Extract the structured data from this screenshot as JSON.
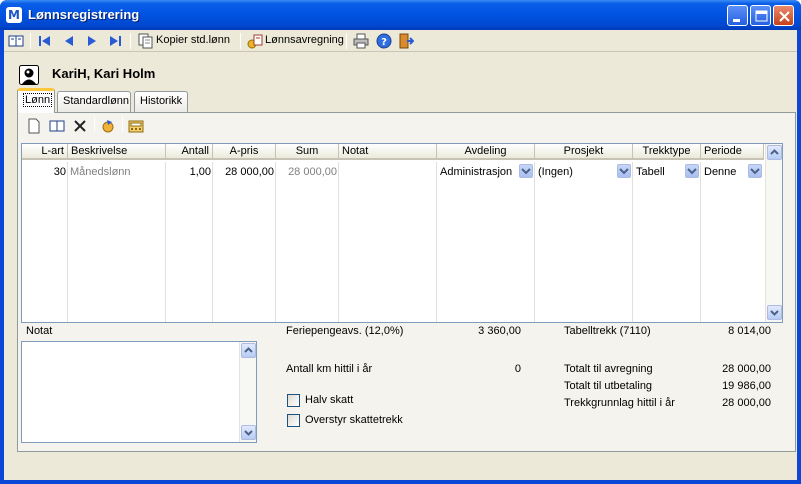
{
  "window": {
    "title": "Lønnsregistrering",
    "app_icon_letter": "M"
  },
  "toolbar": {
    "copy_std_label": "Kopier std.lønn",
    "payroll_label": "Lønnsavregning"
  },
  "person": {
    "name": "KariH, Kari Holm"
  },
  "tabs": [
    {
      "label": "Lønn",
      "active": true
    },
    {
      "label": "Standardlønn",
      "active": false
    },
    {
      "label": "Historikk",
      "active": false
    }
  ],
  "grid": {
    "headers": {
      "lart": "L-art",
      "beskrivelse": "Beskrivelse",
      "antall": "Antall",
      "apris": "A-pris",
      "sum": "Sum",
      "notat": "Notat",
      "avdeling": "Avdeling",
      "prosjekt": "Prosjekt",
      "trekktype": "Trekktype",
      "periode": "Periode"
    },
    "rows": [
      {
        "lart": "30",
        "beskrivelse": "Månedslønn",
        "antall": "1,00",
        "apris": "28 000,00",
        "sum": "28 000,00",
        "notat": "",
        "avdeling": "Administrasjon",
        "prosjekt": "(Ingen)",
        "trekktype": "Tabell",
        "periode": "Denne"
      }
    ]
  },
  "summary": {
    "notat_label": "Notat",
    "feriepenge_label": "Feriepengeavs. (12,0%)",
    "feriepenge_value": "3 360,00",
    "km_label": "Antall km hittil i år",
    "km_value": "0",
    "halv_skatt_label": "Halv skatt",
    "overstyr_label": "Overstyr skattetrekk",
    "tabelltrekk_label": "Tabelltrekk (7110)",
    "tabelltrekk_value": "8 014,00",
    "avregning_label": "Totalt til avregning",
    "avregning_value": "28 000,00",
    "utbetaling_label": "Totalt til utbetaling",
    "utbetaling_value": "19 986,00",
    "grunnlag_label": "Trekkgrunnlag hittil i år",
    "grunnlag_value": "28 000,00"
  },
  "colors": {
    "titlebar": "#0054e3",
    "client": "#ece9d8",
    "tab_highlight": "#ffc83c",
    "grid_border": "#7f9db9"
  },
  "icons": [
    "book-icon",
    "first-record-icon",
    "prev-record-icon",
    "next-record-icon",
    "last-record-icon",
    "copy-icon",
    "payroll-icon",
    "print-icon",
    "help-icon",
    "exit-icon",
    "person-icon",
    "new-icon",
    "open-icon",
    "delete-icon",
    "refresh-icon",
    "calculate-icon"
  ]
}
